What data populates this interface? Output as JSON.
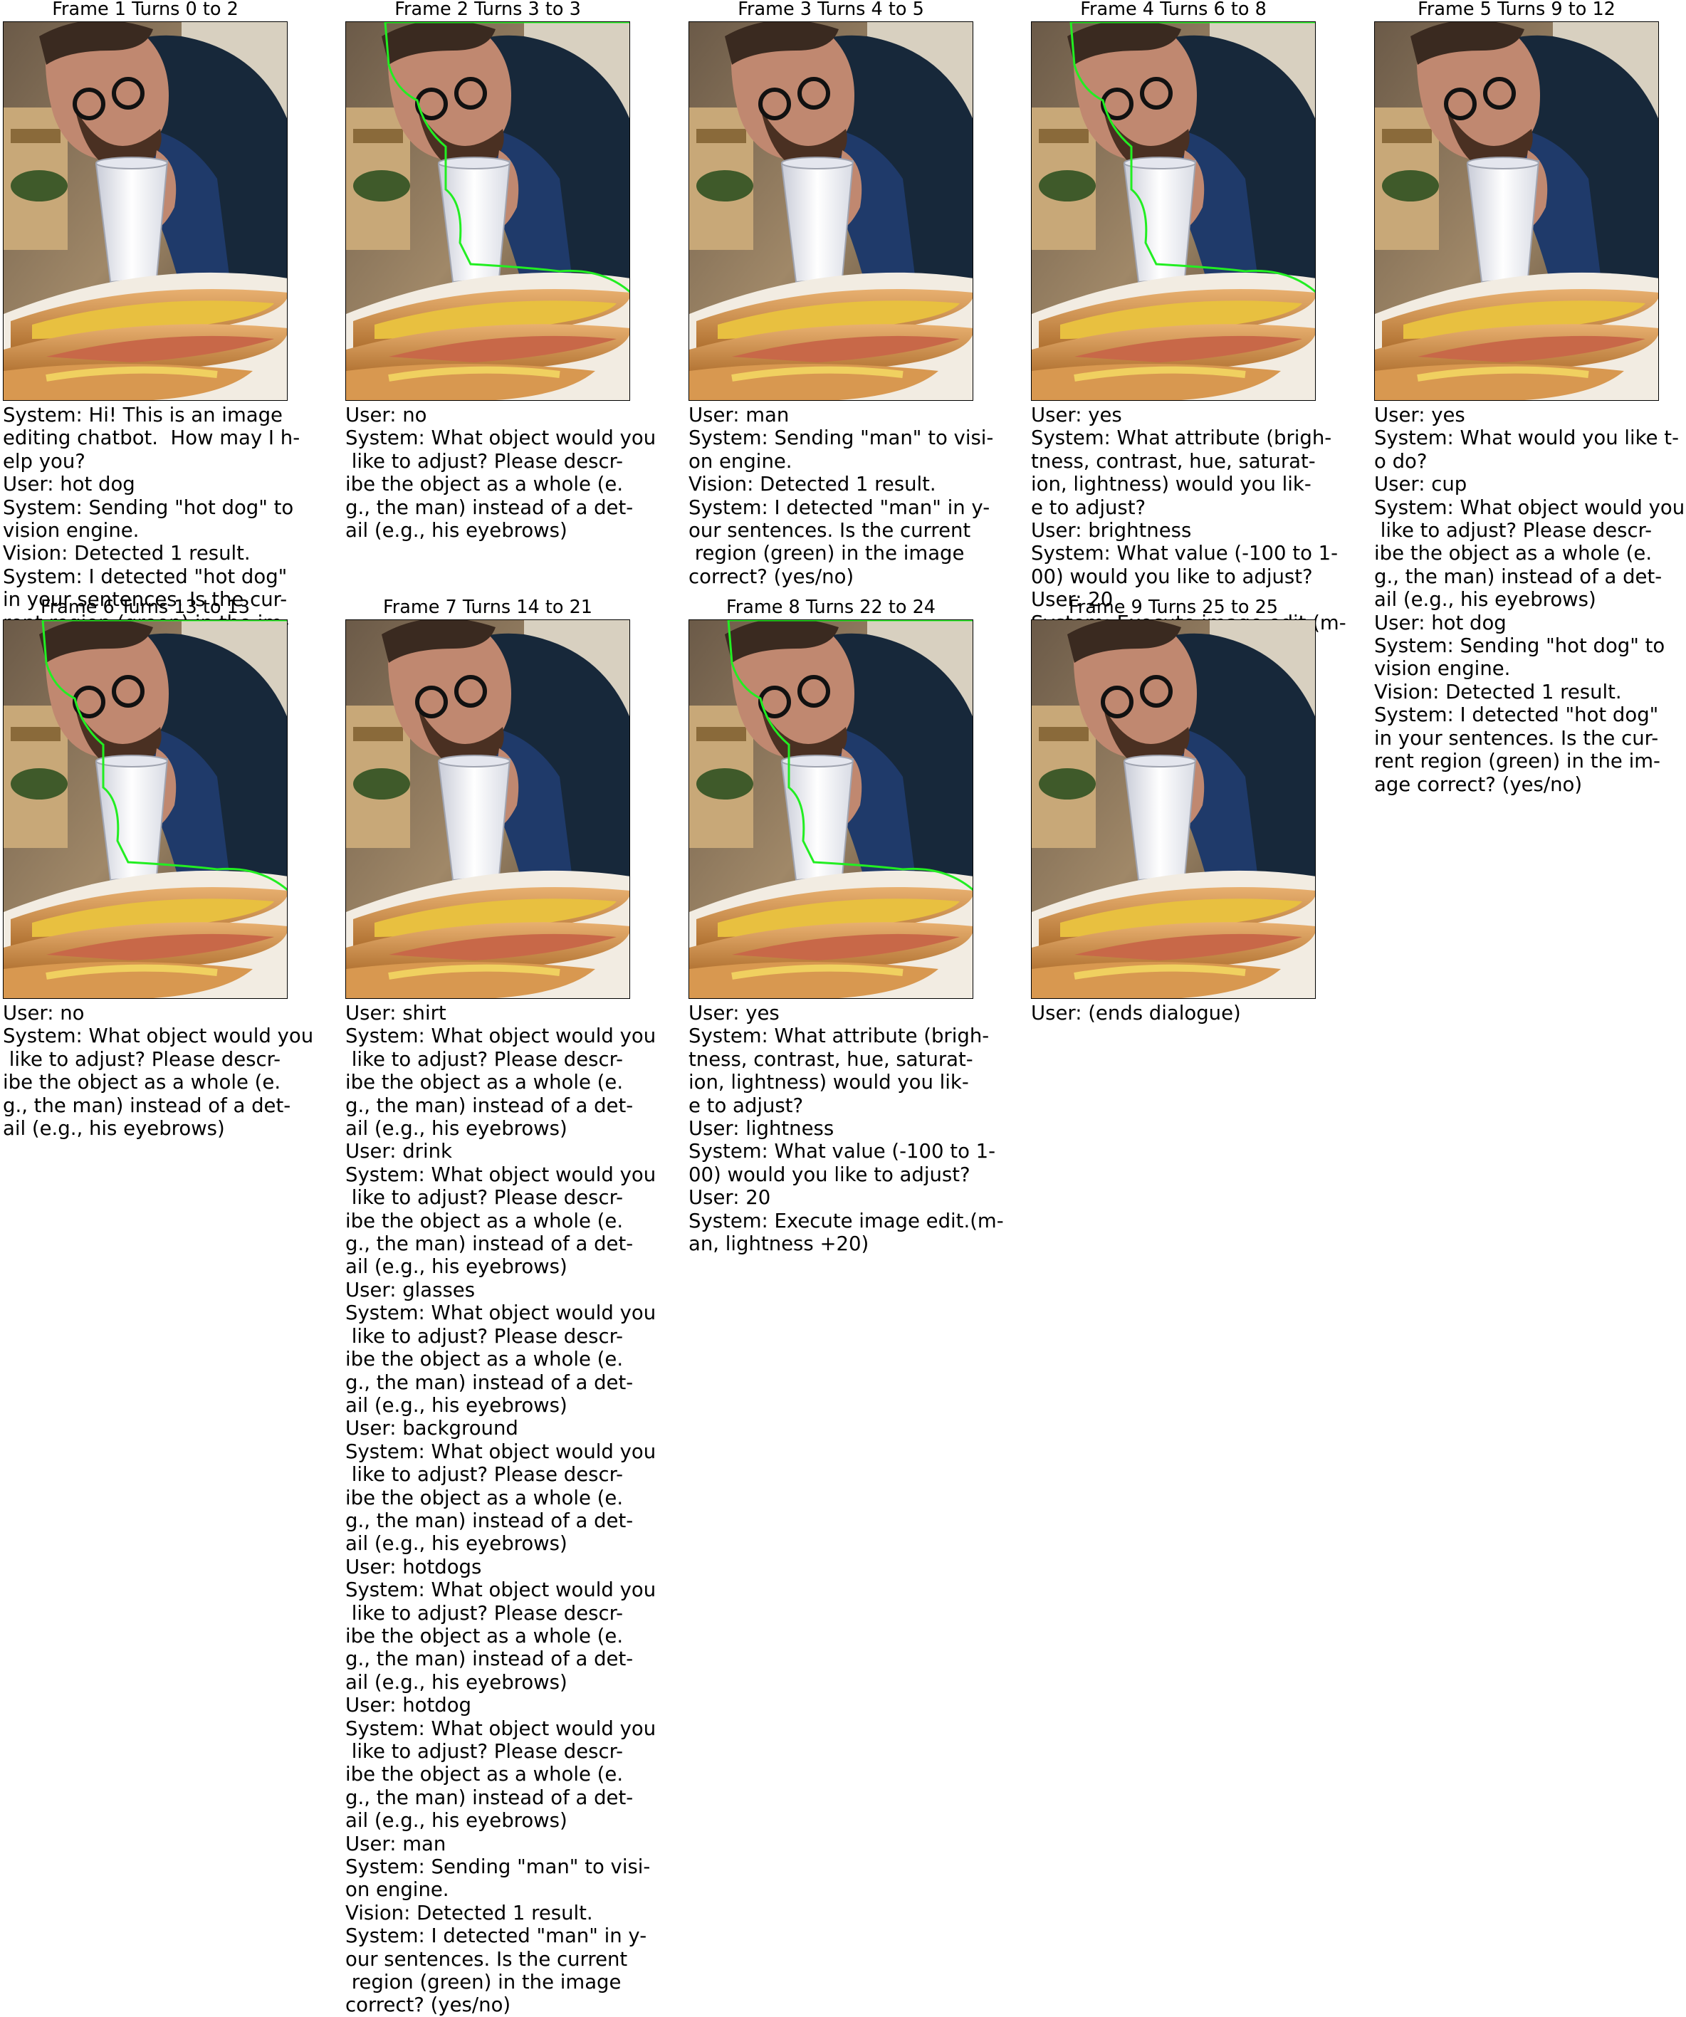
{
  "frames": [
    {
      "title": "Frame 1 Turns 0 to 2",
      "mask": "none",
      "turns": [
        "System: Hi! This is an image",
        "editing chatbot.  How may I h-",
        "elp you?",
        "User: hot dog",
        "System: Sending \"hot dog\" to",
        "vision engine.",
        "Vision: Detected 1 result.",
        "System: I detected \"hot dog\"",
        "in your sentences. Is the cur-",
        "rent region (green) in the im-"
      ]
    },
    {
      "title": "Frame 2 Turns 3 to 3",
      "mask": "man",
      "turns": [
        "User: no",
        "System: What object would you",
        " like to adjust? Please descr-",
        "ibe the object as a whole (e.",
        "g., the man) instead of a det-",
        "ail (e.g., his eyebrows)"
      ]
    },
    {
      "title": "Frame 3 Turns 4 to 5",
      "mask": "none",
      "turns": [
        "User: man",
        "System: Sending \"man\" to visi-",
        "on engine.",
        "Vision: Detected 1 result.",
        "System: I detected \"man\" in y-",
        "our sentences. Is the current",
        " region (green) in the image",
        "correct? (yes/no)"
      ]
    },
    {
      "title": "Frame 4 Turns 6 to 8",
      "mask": "man",
      "turns": [
        "User: yes",
        "System: What attribute (brigh-",
        "tness, contrast, hue, saturat-",
        "ion, lightness) would you lik-",
        "e to adjust?",
        "User: brightness",
        "System: What value (-100 to 1-",
        "00) would you like to adjust?",
        "User: 20",
        "System: Execute image edit.(m-"
      ]
    },
    {
      "title": "Frame 5 Turns 9 to 12",
      "mask": "none",
      "turns": [
        "User: yes",
        "System: What would you like t-",
        "o do?",
        "User: cup",
        "System: What object would you",
        " like to adjust? Please descr-",
        "ibe the object as a whole (e.",
        "g., the man) instead of a det-",
        "ail (e.g., his eyebrows)",
        "User: hot dog",
        "System: Sending \"hot dog\" to",
        "vision engine.",
        "Vision: Detected 1 result.",
        "System: I detected \"hot dog\"",
        "in your sentences. Is the cur-",
        "rent region (green) in the im-",
        "age correct? (yes/no)"
      ]
    },
    {
      "title": "Frame 6 Turns 13 to 13",
      "mask": "man",
      "turns": [
        "User: no",
        "System: What object would you",
        " like to adjust? Please descr-",
        "ibe the object as a whole (e.",
        "g., the man) instead of a det-",
        "ail (e.g., his eyebrows)"
      ]
    },
    {
      "title": "Frame 7 Turns 14 to 21",
      "mask": "none",
      "turns": [
        "User: shirt",
        "System: What object would you",
        " like to adjust? Please descr-",
        "ibe the object as a whole (e.",
        "g., the man) instead of a det-",
        "ail (e.g., his eyebrows)",
        "User: drink",
        "System: What object would you",
        " like to adjust? Please descr-",
        "ibe the object as a whole (e.",
        "g., the man) instead of a det-",
        "ail (e.g., his eyebrows)",
        "User: glasses",
        "System: What object would you",
        " like to adjust? Please descr-",
        "ibe the object as a whole (e.",
        "g., the man) instead of a det-",
        "ail (e.g., his eyebrows)",
        "User: background",
        "System: What object would you",
        " like to adjust? Please descr-",
        "ibe the object as a whole (e.",
        "g., the man) instead of a det-",
        "ail (e.g., his eyebrows)",
        "User: hotdogs",
        "System: What object would you",
        " like to adjust? Please descr-",
        "ibe the object as a whole (e.",
        "g., the man) instead of a det-",
        "ail (e.g., his eyebrows)",
        "User: hotdog",
        "System: What object would you",
        " like to adjust? Please descr-",
        "ibe the object as a whole (e.",
        "g., the man) instead of a det-",
        "ail (e.g., his eyebrows)",
        "User: man",
        "System: Sending \"man\" to visi-",
        "on engine.",
        "Vision: Detected 1 result.",
        "System: I detected \"man\" in y-",
        "our sentences. Is the current",
        " region (green) in the image",
        "correct? (yes/no)"
      ]
    },
    {
      "title": "Frame 8 Turns 22 to 24",
      "mask": "man",
      "turns": [
        "User: yes",
        "System: What attribute (brigh-",
        "tness, contrast, hue, saturat-",
        "ion, lightness) would you lik-",
        "e to adjust?",
        "User: lightness",
        "System: What value (-100 to 1-",
        "00) would you like to adjust?",
        "User: 20",
        "System: Execute image edit.(m-",
        "an, lightness +20)"
      ]
    },
    {
      "title": "Frame 9 Turns 25 to 25",
      "mask": "none",
      "turns": [
        "User: (ends dialogue)"
      ]
    }
  ],
  "colors": {
    "mask_outline": "#22ee22"
  }
}
